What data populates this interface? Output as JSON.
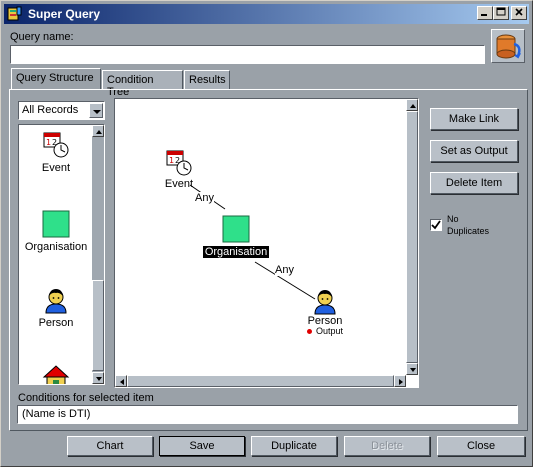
{
  "window": {
    "title": "Super Query"
  },
  "query_name": {
    "label": "Query name:",
    "value": ""
  },
  "tabs": [
    {
      "label": "Query Structure"
    },
    {
      "label": "Condition Tree"
    },
    {
      "label": "Results"
    }
  ],
  "record_filter": {
    "selected": "All Records"
  },
  "palette": [
    {
      "label": "Event",
      "icon": "calendar-clock-icon"
    },
    {
      "label": "Organisation",
      "icon": "green-square-icon"
    },
    {
      "label": "Person",
      "icon": "person-icon"
    },
    {
      "label": "",
      "icon": "house-icon"
    }
  ],
  "canvas": {
    "nodes": [
      {
        "label": "Event"
      },
      {
        "label": "Organisation"
      },
      {
        "label": "Person",
        "output_label": "Output"
      }
    ],
    "links": [
      {
        "label": "Any"
      },
      {
        "label": "Any"
      }
    ]
  },
  "side_buttons": {
    "make_link": "Make Link",
    "set_as_output": "Set as Output",
    "delete_item": "Delete Item"
  },
  "no_duplicates": {
    "label_line1": "No",
    "label_line2": "Duplicates",
    "checked": true
  },
  "conditions": {
    "label": "Conditions for selected item",
    "value": "(Name is DTI)"
  },
  "bottom_buttons": {
    "chart": "Chart",
    "save": "Save",
    "duplicate": "Duplicate",
    "delete": "Delete",
    "close": "Close"
  },
  "colors": {
    "accent": "#0a246a",
    "node_fill": "#2fe08a",
    "output_dot": "#e00000"
  }
}
